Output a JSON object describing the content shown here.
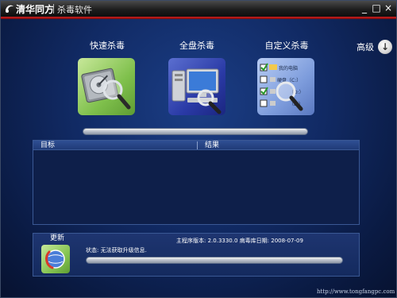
{
  "titlebar": {
    "brand": "清华同方",
    "app_title": "杀毒软件",
    "min_glyph": "_",
    "max_glyph": "□",
    "close_glyph": "×"
  },
  "modes": {
    "quick_label": "快速杀毒",
    "full_label": "全盘杀毒",
    "custom_label": "自定义杀毒",
    "custom_card_items": [
      "我的电脑",
      "硬盘（C:）",
      "（D:）",
      "（E:）"
    ]
  },
  "advanced": {
    "label": "高级",
    "icon": "down-arrow-icon"
  },
  "results": {
    "col_target": "目标",
    "col_result": "结果",
    "rows": []
  },
  "update": {
    "title": "更新",
    "version_text": "主程序版本:   2.0.3330.0  病毒库日期:   2008-07-09",
    "status_text": "状态:   无法获取升级信息."
  },
  "footer": {
    "url": "http://www.tongfangpc.com"
  },
  "colors": {
    "accent_red": "#c01818",
    "panel_blue": "#0e1f4a",
    "bg_blue": "#112a64"
  }
}
